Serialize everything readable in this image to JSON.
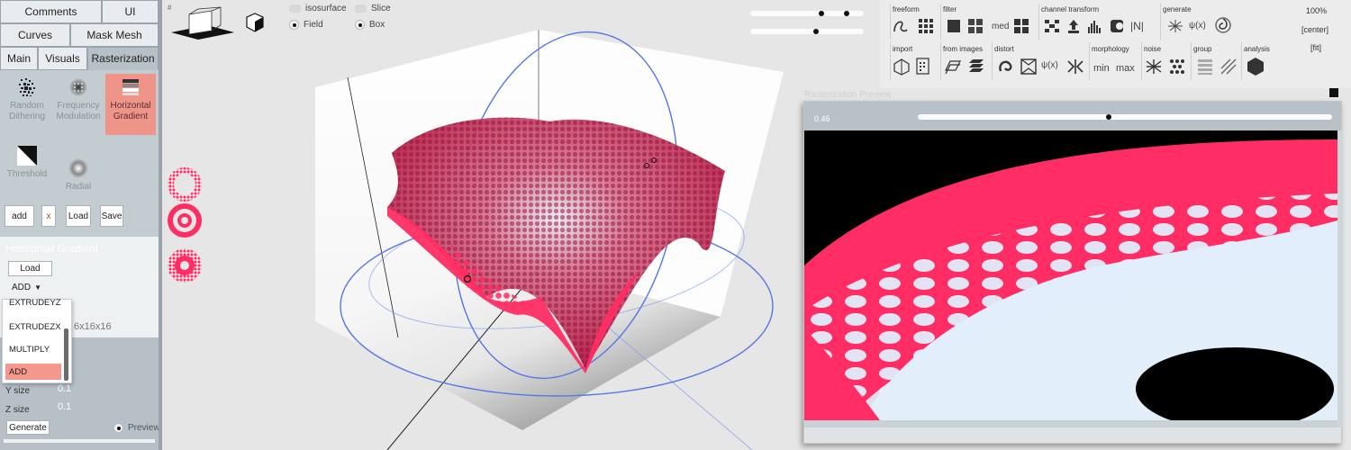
{
  "tabs_row1": [
    {
      "label": "Comments"
    },
    {
      "label": "UI"
    }
  ],
  "tabs_row2": [
    {
      "label": "Curves"
    },
    {
      "label": "Mask Mesh"
    }
  ],
  "tabs_row3": [
    {
      "label": "Main"
    },
    {
      "label": "Visuals"
    },
    {
      "label": "Rasterization"
    }
  ],
  "tools": [
    {
      "label": "Random Dithering",
      "icon": "random-dithering-icon"
    },
    {
      "label": "Frequency Modulation",
      "icon": "frequency-modulation-icon"
    },
    {
      "label": "Horizontal Gradient",
      "icon": "horizontal-gradient-icon"
    },
    {
      "label": "Threshold",
      "icon": "threshold-icon"
    },
    {
      "label": "Radial",
      "icon": "radial-icon"
    }
  ],
  "tool_buttons": {
    "add": "add",
    "remove": "x",
    "load": "Load",
    "save": "Save"
  },
  "params": {
    "title": "Horizontal Gradient",
    "load": "Load",
    "blend_mode": "ADD",
    "resolution": "6x16x16",
    "y_label": "Y size",
    "y_value": "0.1",
    "z_label": "Z size",
    "z_value": "0.1",
    "generate": "Generate",
    "preview": "Preview"
  },
  "blend_options": [
    "EXTRUDEYZ",
    "EXTRUDEZX",
    "MULTIPLY",
    "ADD"
  ],
  "viewport": {
    "corner_label": "#",
    "isosurface": "isosurface",
    "slice": "Slice",
    "field": "Field",
    "box": "Box",
    "field_checked": true,
    "box_checked": true,
    "slider1_low": 0.63,
    "slider1_high": 0.87,
    "slider2": 0.58,
    "colors": {
      "surface": "#ff2d63",
      "ring": "#5577e6"
    }
  },
  "toolbar": {
    "groups": [
      {
        "label": "freeform"
      },
      {
        "label": "filter"
      },
      {
        "label": "channel transform"
      },
      {
        "label": "generate"
      },
      {
        "label": "import"
      },
      {
        "label": "from images"
      },
      {
        "label": "distort"
      },
      {
        "label": "morphology"
      },
      {
        "label": "noise"
      },
      {
        "label": "group"
      },
      {
        "label": "analysis"
      }
    ],
    "filter_med": "med",
    "transform_n": "|N|",
    "generate_psi": "ψ(x)",
    "distort_psi": "ψ(x)",
    "morph_min": "min",
    "morph_max": "max",
    "zoom": "100%",
    "center": "[center]",
    "fit": "[fit]"
  },
  "raster_preview": {
    "title": "Rasterization Preview",
    "value": "0.46",
    "slider": 0.46
  }
}
